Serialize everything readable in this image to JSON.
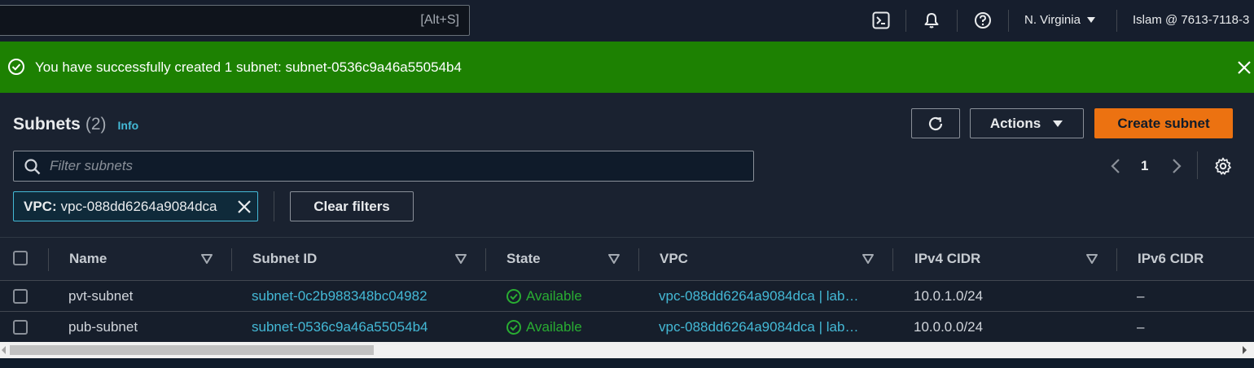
{
  "topnav": {
    "search_shortcut": "[Alt+S]",
    "icons": [
      "cloudshell-icon",
      "bell-icon",
      "help-icon"
    ],
    "region": "N. Virginia",
    "account": "Islam @ 7613-7118-3"
  },
  "flash": {
    "message": "You have successfully created 1 subnet: subnet-0536c9a46a55054b4",
    "color": "#1d8102"
  },
  "header": {
    "title": "Subnets",
    "count": "(2)",
    "info": "Info",
    "actions_label": "Actions",
    "create_label": "Create subnet",
    "accent": "#ec7211"
  },
  "filter": {
    "placeholder": "Filter subnets",
    "token_key": "VPC:",
    "token_value": "vpc-088dd6264a9084dca",
    "clear_label": "Clear filters"
  },
  "pagination": {
    "page": "1"
  },
  "table": {
    "columns": [
      "Name",
      "Subnet ID",
      "State",
      "VPC",
      "IPv4 CIDR",
      "IPv6 CIDR"
    ],
    "rows": [
      {
        "name": "pvt-subnet",
        "subnet_id": "subnet-0c2b988348bc04982",
        "state": "Available",
        "vpc": "vpc-088dd6264a9084dca | lab…",
        "ipv4": "10.0.1.0/24",
        "ipv6": "–"
      },
      {
        "name": "pub-subnet",
        "subnet_id": "subnet-0536c9a46a55054b4",
        "state": "Available",
        "vpc": "vpc-088dd6264a9084dca | lab…",
        "ipv4": "10.0.0.0/24",
        "ipv6": "–"
      }
    ]
  }
}
